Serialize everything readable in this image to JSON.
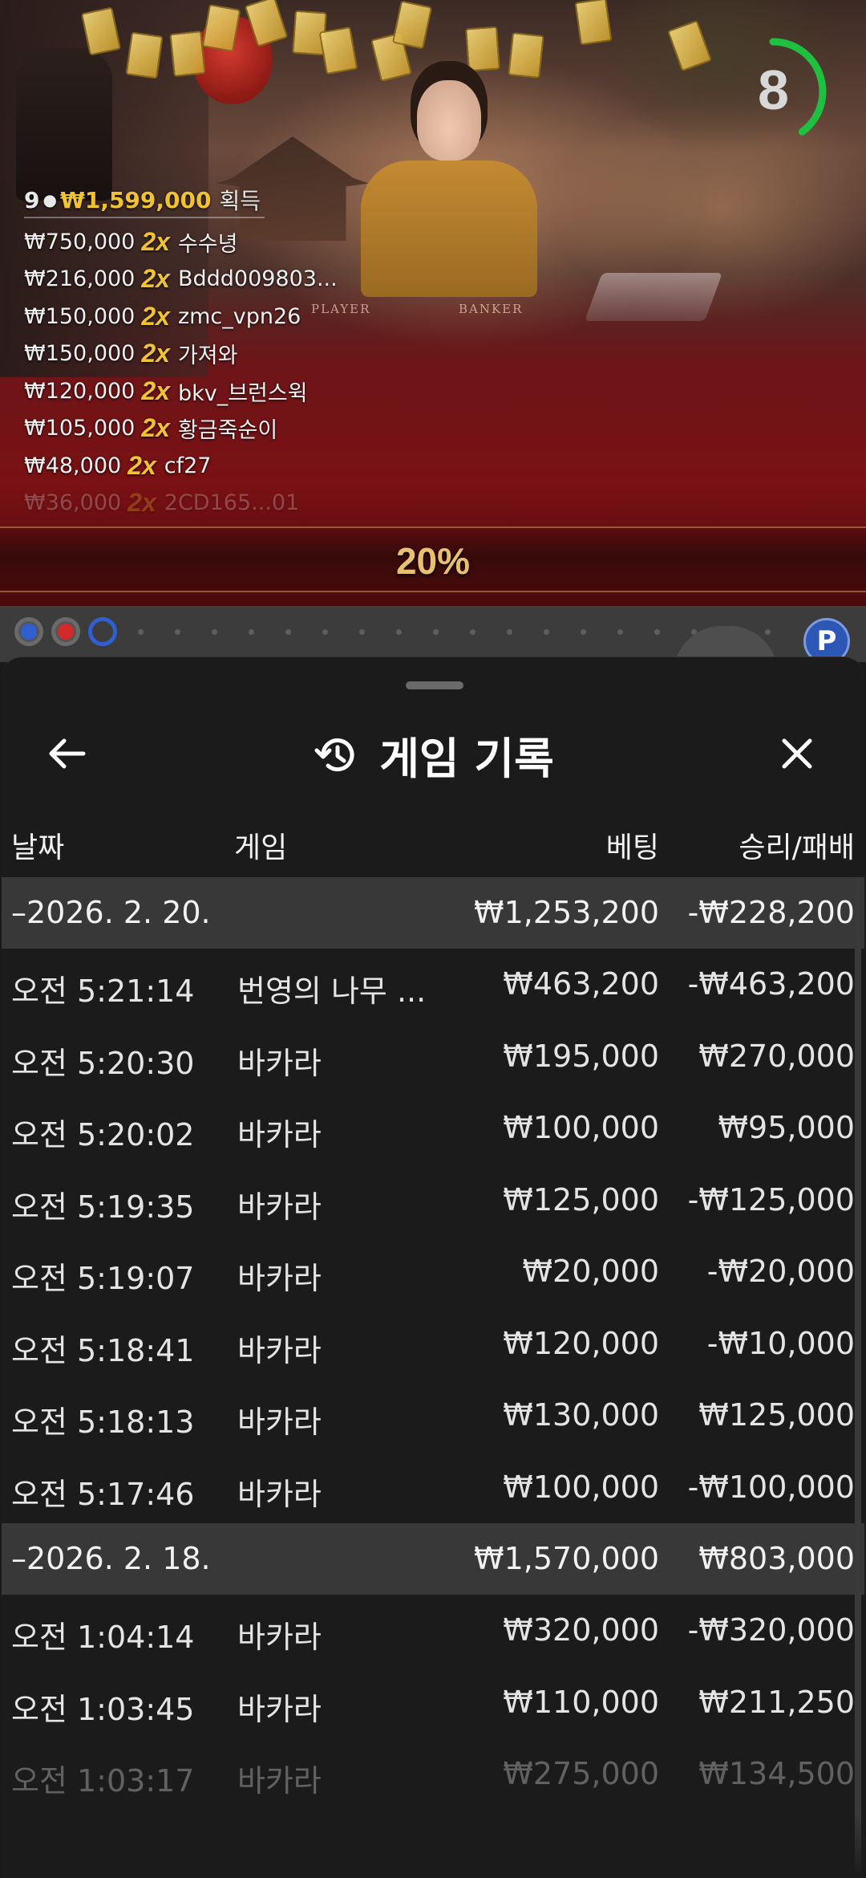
{
  "timer": {
    "value": "8",
    "progress": 0.4,
    "color": "#1fbf3f"
  },
  "winners": {
    "count": "9",
    "person_icon": "person-icon",
    "total": "₩1,599,000",
    "total_suffix": "획득",
    "rows": [
      {
        "amount": "₩750,000",
        "mult": "2x",
        "name": "수수녕"
      },
      {
        "amount": "₩216,000",
        "mult": "2x",
        "name": "Bddd009803..."
      },
      {
        "amount": "₩150,000",
        "mult": "2x",
        "name": "zmc_vpn26"
      },
      {
        "amount": "₩150,000",
        "mult": "2x",
        "name": "가져와"
      },
      {
        "amount": "₩120,000",
        "mult": "2x",
        "name": "bkv_브런스윅"
      },
      {
        "amount": "₩105,000",
        "mult": "2x",
        "name": "황금죽순이"
      },
      {
        "amount": "₩48,000",
        "mult": "2x",
        "name": "cf27"
      },
      {
        "amount": "₩36,000",
        "mult": "2x",
        "name": "2CD165...01"
      }
    ]
  },
  "table_labels": {
    "player": "PLAYER",
    "banker": "BANKER"
  },
  "banner": {
    "percent": "20%"
  },
  "road": {
    "circles": [
      {
        "color": "#2f5fd0",
        "fill": true
      },
      {
        "color": "#d22a2a",
        "fill": true
      },
      {
        "color": "#2f5fd0",
        "fill": false
      }
    ],
    "badge": "P"
  },
  "sheet": {
    "title": "게임 기록",
    "icons": {
      "back": "arrow-left-icon",
      "history": "history-icon",
      "close": "close-icon"
    },
    "columns": {
      "date": "날짜",
      "game": "게임",
      "bet": "베팅",
      "win_loss": "승리/패배"
    },
    "groups": [
      {
        "date": "–2026. 2. 20.",
        "bet_total": "₩1,253,200",
        "wl_total": "-₩228,200",
        "rows": [
          {
            "time": "오전 5:21:14",
            "game": "번영의 나무 ...",
            "bet": "₩463,200",
            "wl": "-₩463,200"
          },
          {
            "time": "오전 5:20:30",
            "game": "바카라",
            "bet": "₩195,000",
            "wl": "₩270,000"
          },
          {
            "time": "오전 5:20:02",
            "game": "바카라",
            "bet": "₩100,000",
            "wl": "₩95,000"
          },
          {
            "time": "오전 5:19:35",
            "game": "바카라",
            "bet": "₩125,000",
            "wl": "-₩125,000"
          },
          {
            "time": "오전 5:19:07",
            "game": "바카라",
            "bet": "₩20,000",
            "wl": "-₩20,000"
          },
          {
            "time": "오전 5:18:41",
            "game": "바카라",
            "bet": "₩120,000",
            "wl": "-₩10,000"
          },
          {
            "time": "오전 5:18:13",
            "game": "바카라",
            "bet": "₩130,000",
            "wl": "₩125,000"
          },
          {
            "time": "오전 5:17:46",
            "game": "바카라",
            "bet": "₩100,000",
            "wl": "-₩100,000"
          }
        ]
      },
      {
        "date": "–2026. 2. 18.",
        "bet_total": "₩1,570,000",
        "wl_total": "₩803,000",
        "rows": [
          {
            "time": "오전 1:04:14",
            "game": "바카라",
            "bet": "₩320,000",
            "wl": "-₩320,000"
          },
          {
            "time": "오전 1:03:45",
            "game": "바카라",
            "bet": "₩110,000",
            "wl": "₩211,250"
          },
          {
            "time": "오전 1:03:17",
            "game": "바카라",
            "bet": "₩275,000",
            "wl": "₩134,500"
          }
        ]
      }
    ]
  }
}
